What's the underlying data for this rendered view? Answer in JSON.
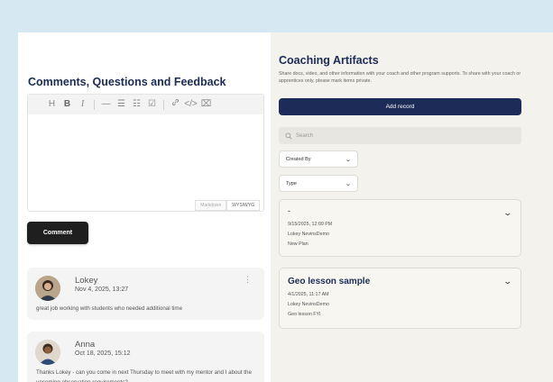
{
  "comments_panel": {
    "title": "Comments, Questions and Feedback",
    "toolbar": [
      "H",
      "B",
      "I",
      "—",
      "☰",
      "☷",
      "☑",
      "🔗",
      "</>",
      "⌧"
    ],
    "modes": [
      "Markdown",
      "WYSIWYG"
    ],
    "comment_button": "Comment",
    "comments": [
      {
        "name": "Lokey",
        "date": "Nov 4, 2025, 13:27",
        "text": "great job working with students who needed additional time",
        "menu": "⋮"
      },
      {
        "name": "Anna",
        "date": "Oct 18, 2025, 15:12",
        "text": "Thanks Lokey - can you come in next Thursday to meet with my mentor and I about the upcoming observation requirements?"
      }
    ]
  },
  "artifacts_panel": {
    "title": "Coaching Artifacts",
    "description": "Share docs, video, and other information with your coach and other program supports. To share with your coach or apprentices only, please mark items private.",
    "add_button": "Add record",
    "search_placeholder": "Search",
    "filters": [
      {
        "label": "Created By"
      },
      {
        "label": "Type"
      }
    ],
    "records": [
      {
        "title": "-",
        "date": "9/15/2025, 12:09 PM",
        "author": "Lokey NevinsDemo",
        "note": "New Plan"
      },
      {
        "title": "Geo lesson sample",
        "date": "4/1/2025, 11:17 AM",
        "author": "Lokey NevinsDemo",
        "note": "Geo lesson FYI"
      }
    ]
  },
  "icons": {
    "search": "search-icon",
    "chevron": "chevron-down-icon",
    "menu": "more-vertical-icon"
  },
  "colors": {
    "accent": "#1c2b57",
    "button_dark": "#1f1f1f",
    "background": "#d6e8f2"
  }
}
